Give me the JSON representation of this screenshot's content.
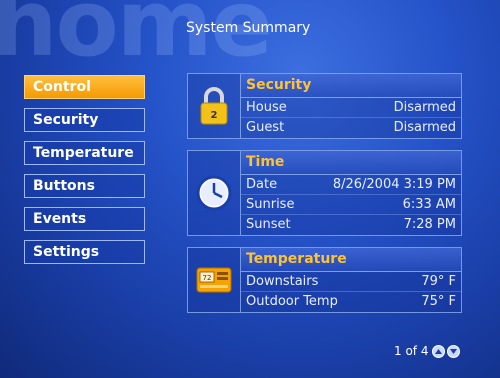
{
  "background_word": "home",
  "page_title": "System Summary",
  "menu": [
    {
      "label": "Control",
      "active": true
    },
    {
      "label": "Security",
      "active": false
    },
    {
      "label": "Temperature",
      "active": false
    },
    {
      "label": "Buttons",
      "active": false
    },
    {
      "label": "Events",
      "active": false
    },
    {
      "label": "Settings",
      "active": false
    }
  ],
  "cards": {
    "security": {
      "title": "Security",
      "icon": "padlock-icon",
      "lock_digit": "2",
      "rows": [
        {
          "label": "House",
          "value": "Disarmed"
        },
        {
          "label": "Guest",
          "value": "Disarmed"
        }
      ]
    },
    "time": {
      "title": "Time",
      "icon": "clock-icon",
      "rows": [
        {
          "label": "Date",
          "value": "8/26/2004 3:19 PM"
        },
        {
          "label": "Sunrise",
          "value": "6:33 AM"
        },
        {
          "label": "Sunset",
          "value": "7:28 PM"
        }
      ]
    },
    "temperature": {
      "title": "Temperature",
      "icon": "thermostat-icon",
      "thermostat_reading": "72",
      "rows": [
        {
          "label": "Downstairs",
          "value": "79° F"
        },
        {
          "label": "Outdoor Temp",
          "value": "75° F"
        }
      ]
    }
  },
  "pager": {
    "text": "1 of 4"
  },
  "colors": {
    "accent": "#f5a300",
    "header_text": "#ffc233",
    "background": "#2553c9"
  }
}
